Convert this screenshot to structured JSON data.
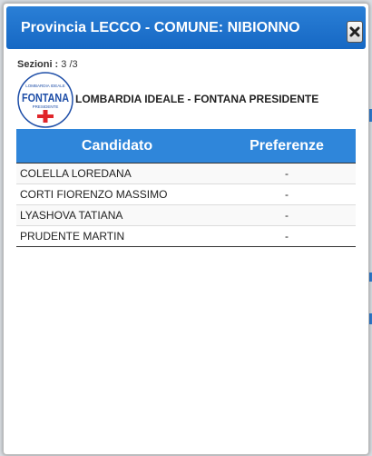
{
  "dialog": {
    "title": "Provincia LECCO - COMUNE: NIBIONNO",
    "close_label": "×"
  },
  "sezioni": {
    "label": "Sezioni :",
    "value": "3 /3"
  },
  "party": {
    "name": "LOMBARDIA IDEALE - FONTANA PRESIDENTE",
    "logo": {
      "top_text": "LOMBARDIA IDEALE",
      "main_text": "FONTANA",
      "sub_text": "PRESIDENTE"
    }
  },
  "table": {
    "headers": [
      "Candidato",
      "Preferenze"
    ],
    "rows": [
      {
        "candidato": "COLELLA LOREDANA",
        "preferenze": "-"
      },
      {
        "candidato": "CORTI FIORENZO MASSIMO",
        "preferenze": "-"
      },
      {
        "candidato": "LYASHOVA TATIANA",
        "preferenze": "-"
      },
      {
        "candidato": "PRUDENTE MARTIN",
        "preferenze": "-"
      }
    ]
  },
  "colors": {
    "header_blue": "#2f86da",
    "title_blue": "#1e72cc",
    "logo_red": "#e0262b",
    "logo_blue": "#1f4fa8"
  }
}
